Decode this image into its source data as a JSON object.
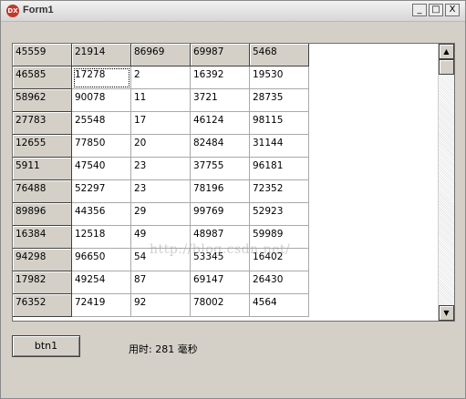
{
  "window": {
    "title": "Form1",
    "icon": "DX"
  },
  "window_buttons": {
    "minimize": "_",
    "maximize": "□",
    "close": "X"
  },
  "grid": {
    "header_row": [
      "45559",
      "21914",
      "86969",
      "69987",
      "5468"
    ],
    "rows": [
      [
        "46585",
        "17278",
        "2",
        "16392",
        "19530"
      ],
      [
        "58962",
        "90078",
        "11",
        "3721",
        "28735"
      ],
      [
        "27783",
        "25548",
        "17",
        "46124",
        "98115"
      ],
      [
        "12655",
        "77850",
        "20",
        "82484",
        "31144"
      ],
      [
        "5911",
        "47540",
        "23",
        "37755",
        "96181"
      ],
      [
        "76488",
        "52297",
        "23",
        "78196",
        "72352"
      ],
      [
        "89896",
        "44356",
        "29",
        "99769",
        "52923"
      ],
      [
        "16384",
        "12518",
        "49",
        "48987",
        "59989"
      ],
      [
        "94298",
        "96650",
        "54",
        "53345",
        "16402"
      ],
      [
        "17982",
        "49254",
        "87",
        "69147",
        "26430"
      ],
      [
        "76352",
        "72419",
        "92",
        "78002",
        "4564"
      ]
    ]
  },
  "watermark": "http://blog.csdn.net/",
  "scrollbar": {
    "up": "▲",
    "down": "▼"
  },
  "button": {
    "label": "btn1"
  },
  "timing_text": "用时: 281 毫秒"
}
